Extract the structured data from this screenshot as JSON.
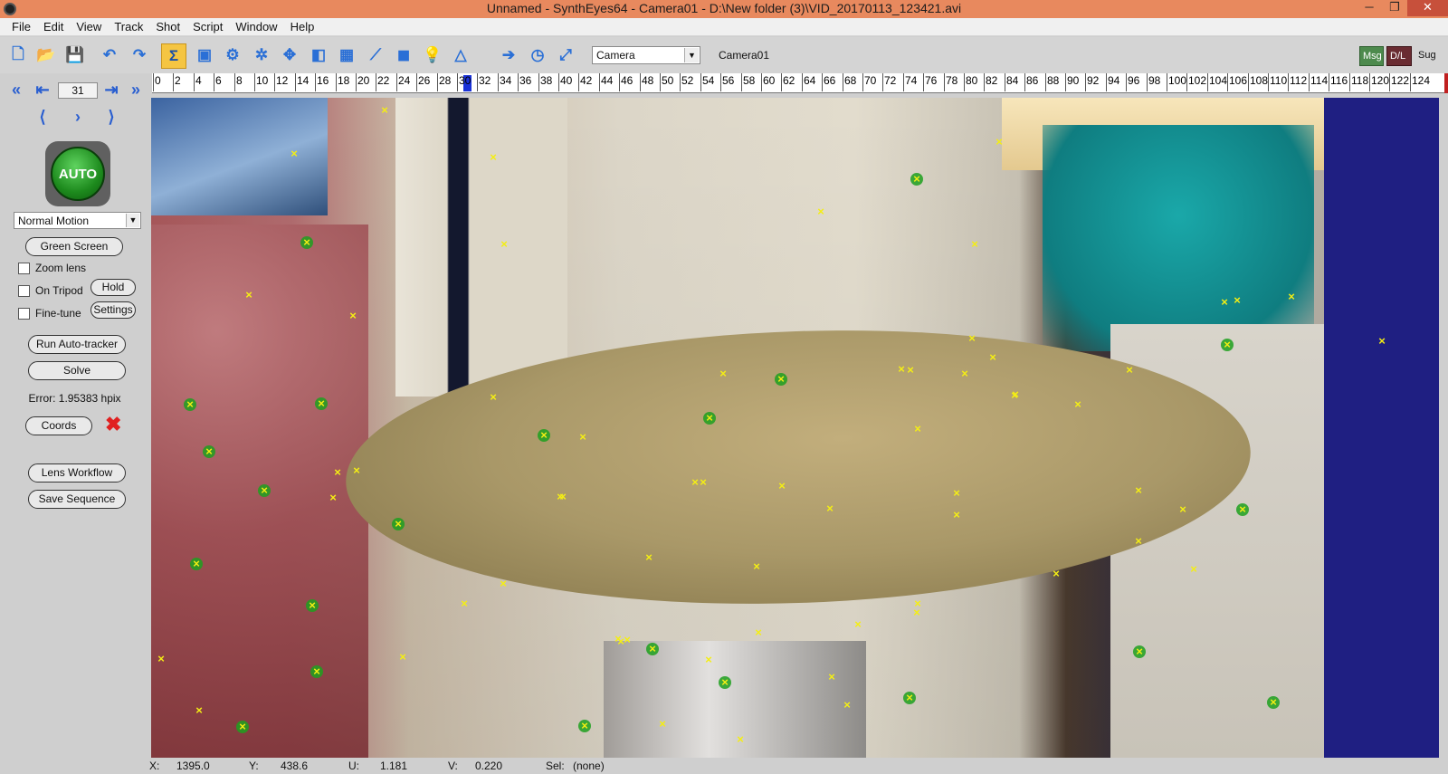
{
  "window": {
    "title": "Unnamed - SynthEyes64 - Camera01 - D:\\New folder (3)\\VID_20170113_123421.avi",
    "controls": {
      "minimize": "─",
      "maximize": "❐",
      "close": "✕"
    }
  },
  "menu": [
    "File",
    "Edit",
    "View",
    "Track",
    "Shot",
    "Script",
    "Window",
    "Help"
  ],
  "toolbar": {
    "icons": [
      "new-file-icon",
      "open-folder-icon",
      "save-icon",
      "undo-icon",
      "redo-icon",
      "sigma-summary-icon",
      "camera-view-icon",
      "gear-solver-icon",
      "coordinates-icon",
      "tracker-icon",
      "shot-icon",
      "calculator-icon",
      "graph-icon",
      "cube-icon",
      "lightbulb-icon",
      "phase-icon",
      "arrow-right-icon",
      "clock-icon",
      "fit-frame-icon"
    ],
    "glyphs": [
      "🗋",
      "📂",
      "💾",
      "↶",
      "↷",
      "Σ",
      "▣",
      "⚙",
      "✲",
      "✥",
      "◧",
      "▦",
      "⟋",
      "◼",
      "💡",
      "△",
      "➔",
      "◷",
      "⤢"
    ],
    "view_select": "Camera",
    "camera_label": "Camera01",
    "msg": "Msg",
    "dl": "D/L",
    "sug": "Sug"
  },
  "left_panel": {
    "frame": "31",
    "auto_label": "AUTO",
    "motion_select": "Normal Motion",
    "green_screen": "Green Screen",
    "zoom_lens": "Zoom lens",
    "on_tripod": "On Tripod",
    "hold": "Hold",
    "fine_tune": "Fine-tune",
    "settings": "Settings",
    "run_autotracker": "Run Auto-tracker",
    "solve": "Solve",
    "error": "Error: 1.95383 hpix",
    "coords": "Coords",
    "lens_workflow": "Lens Workflow",
    "save_sequence": "Save Sequence"
  },
  "timeline": {
    "labels": [
      "0",
      "2",
      "4",
      "6",
      "8",
      "10",
      "12",
      "14",
      "16",
      "18",
      "20",
      "22",
      "24",
      "26",
      "28",
      "30",
      "32",
      "34",
      "36",
      "38",
      "40",
      "42",
      "44",
      "46",
      "48",
      "50",
      "52",
      "54",
      "56",
      "58",
      "60",
      "62",
      "64",
      "66",
      "68",
      "70",
      "72",
      "74",
      "76",
      "78",
      "80",
      "82",
      "84",
      "86",
      "88",
      "90",
      "92",
      "94",
      "96",
      "98",
      "100",
      "102",
      "104",
      "106",
      "108",
      "110",
      "112",
      "114",
      "116",
      "118",
      "120",
      "122",
      "124"
    ],
    "current_frame": 31,
    "max_frame": 124
  },
  "status": {
    "x_label": "X:",
    "x_value": "1395.0",
    "y_label": "Y:",
    "y_value": "438.6",
    "u_label": "U:",
    "u_value": "1.181",
    "v_label": "V:",
    "v_value": "0.220",
    "sel_label": "Sel:",
    "sel_value": "(none)"
  }
}
